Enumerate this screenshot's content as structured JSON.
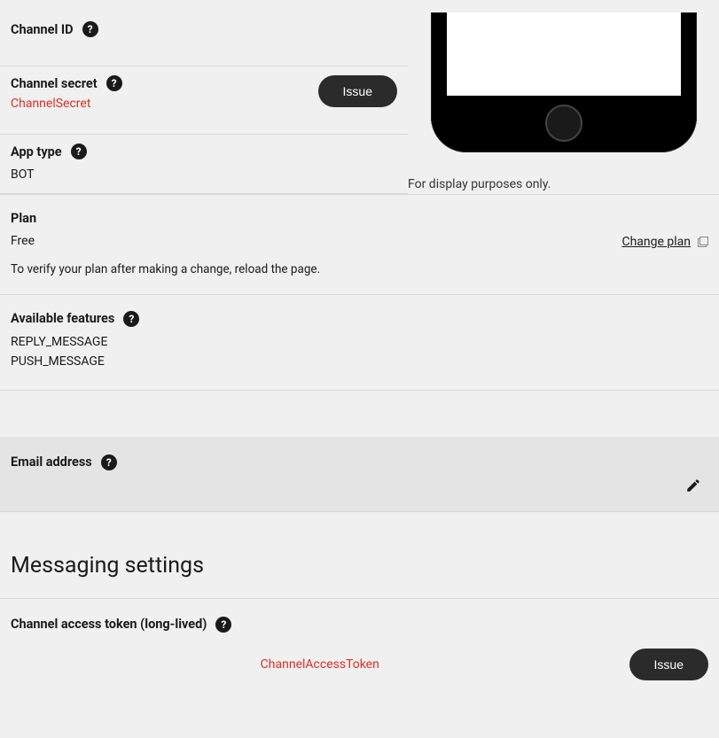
{
  "phone_caption": "For display purposes only.",
  "channel_id": {
    "label": "Channel ID"
  },
  "channel_secret": {
    "label": "Channel secret",
    "value": "ChannelSecret",
    "issue_button": "Issue"
  },
  "app_type": {
    "label": "App type",
    "value": "BOT"
  },
  "plan": {
    "label": "Plan",
    "value": "Free",
    "change_link": "Change plan",
    "note": "To verify your plan after making a change, reload the page."
  },
  "features": {
    "label": "Available features",
    "items": [
      "REPLY_MESSAGE",
      "PUSH_MESSAGE"
    ]
  },
  "email": {
    "label": "Email address"
  },
  "messaging_heading": "Messaging settings",
  "access_token": {
    "label": "Channel access token (long-lived)",
    "value": "ChannelAccessToken",
    "issue_button": "Issue"
  }
}
